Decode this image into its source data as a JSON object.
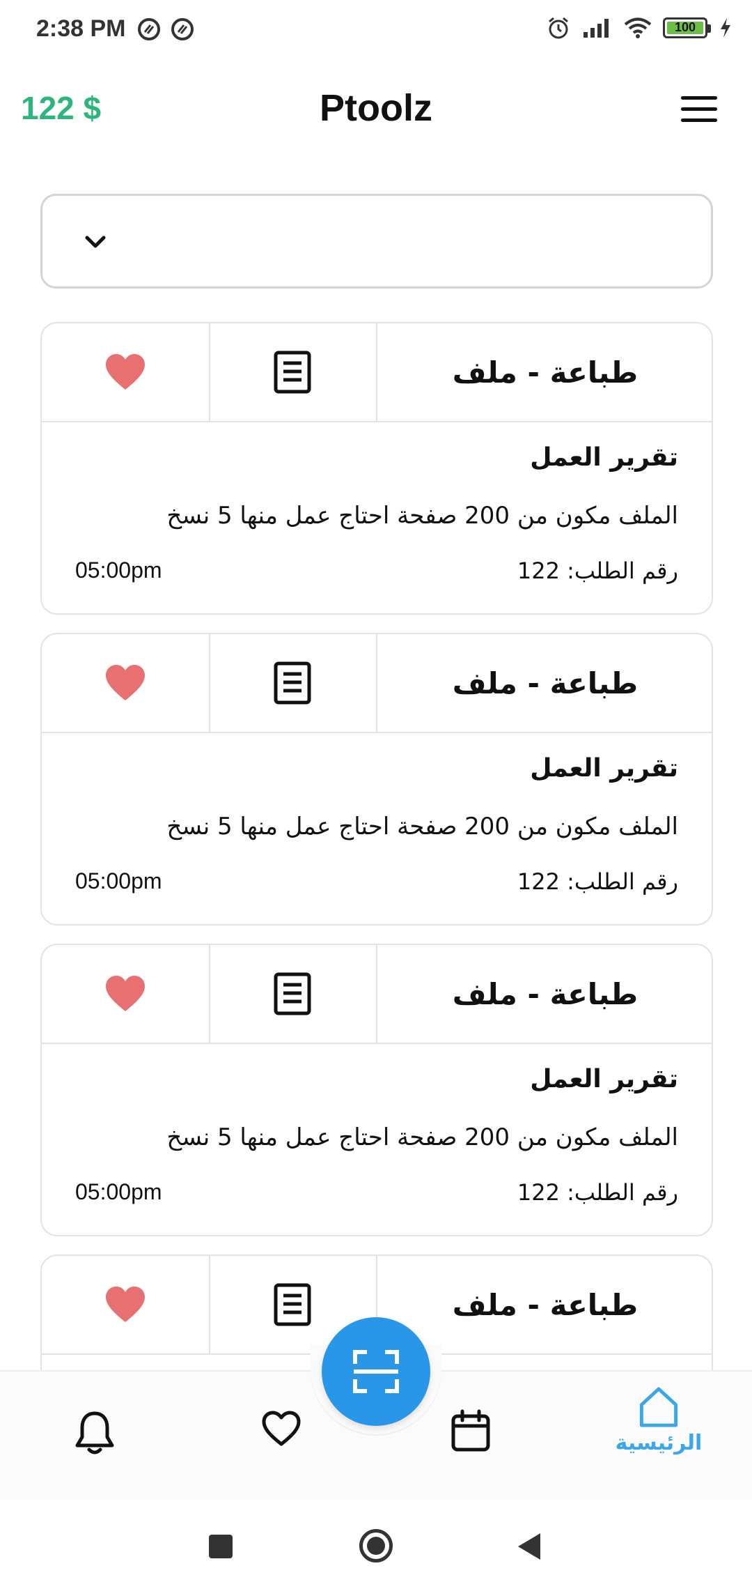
{
  "status_bar": {
    "time": "2:38 PM",
    "battery": "100"
  },
  "header": {
    "balance": "122 $",
    "title": "Ptoolz"
  },
  "filter": {
    "selected": ""
  },
  "cards": [
    {
      "type": "طباعة - ملف",
      "title": "تقرير العمل",
      "description": "الملف مكون من 200 صفحة احتاج عمل منها 5 نسخ",
      "order": "رقم الطلب: 122",
      "time": "05:00pm"
    },
    {
      "type": "طباعة - ملف",
      "title": "تقرير العمل",
      "description": "الملف مكون من 200 صفحة احتاج عمل منها 5 نسخ",
      "order": "رقم الطلب: 122",
      "time": "05:00pm"
    },
    {
      "type": "طباعة - ملف",
      "title": "تقرير العمل",
      "description": "الملف مكون من 200 صفحة احتاج عمل منها 5 نسخ",
      "order": "رقم الطلب: 122",
      "time": "05:00pm"
    },
    {
      "type": "طباعة - ملف",
      "title": "",
      "description": "",
      "order": "",
      "time": ""
    }
  ],
  "bottom_nav": {
    "items": [
      {
        "icon": "bell-icon",
        "label": ""
      },
      {
        "icon": "heart-outline-icon",
        "label": ""
      },
      {
        "icon": "calendar-icon",
        "label": ""
      },
      {
        "icon": "home-icon",
        "label": "الرئيسية",
        "active": true
      }
    ],
    "fab_icon": "scan-icon"
  },
  "colors": {
    "accent": "#2a96e8",
    "balance": "#2db67c",
    "heart": "#e87070",
    "active_nav": "#3aa7e8"
  }
}
